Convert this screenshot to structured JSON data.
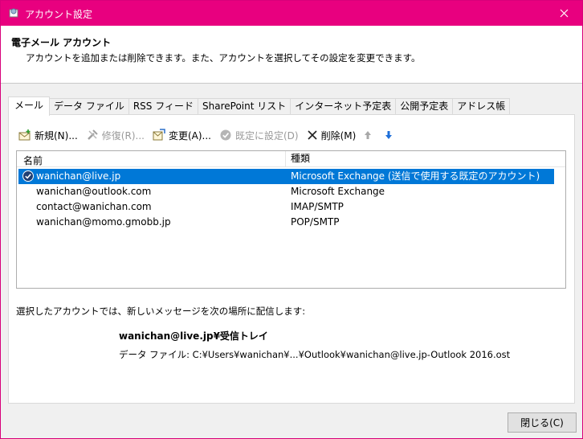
{
  "window": {
    "title": "アカウント設定",
    "accent_color": "#e8007f"
  },
  "header": {
    "title": "電子メール アカウント",
    "description": "アカウントを追加または削除できます。また、アカウントを選択してその設定を変更できます。"
  },
  "tabs": [
    {
      "label": "メール",
      "active": true
    },
    {
      "label": "データ ファイル"
    },
    {
      "label": "RSS フィード"
    },
    {
      "label": "SharePoint リスト"
    },
    {
      "label": "インターネット予定表"
    },
    {
      "label": "公開予定表"
    },
    {
      "label": "アドレス帳"
    }
  ],
  "toolbar": {
    "new_label": "新規(N)...",
    "repair_label": "修復(R)...",
    "change_label": "変更(A)...",
    "default_label": "既定に設定(D)",
    "remove_label": "削除(M)"
  },
  "list": {
    "col_name": "名前",
    "col_type": "種類",
    "rows": [
      {
        "name": "wanichan@live.jp",
        "type": "Microsoft Exchange (送信で使用する既定のアカウント)",
        "selected": true
      },
      {
        "name": "wanichan@outlook.com",
        "type": "Microsoft Exchange"
      },
      {
        "name": "contact@wanichan.com",
        "type": "IMAP/SMTP"
      },
      {
        "name": "wanichan@momo.gmobb.jp",
        "type": "POP/SMTP"
      }
    ]
  },
  "delivery": {
    "info": "選択したアカウントでは、新しいメッセージを次の場所に配信します:",
    "target": "wanichan@live.jp¥受信トレイ",
    "path": "データ ファイル: C:¥Users¥wanichan¥...¥Outlook¥wanichan@live.jp-Outlook 2016.ost"
  },
  "footer": {
    "close_label": "閉じる(C)"
  },
  "colors": {
    "selection": "#0078d7",
    "move_arrow": "#1e6fd9"
  }
}
